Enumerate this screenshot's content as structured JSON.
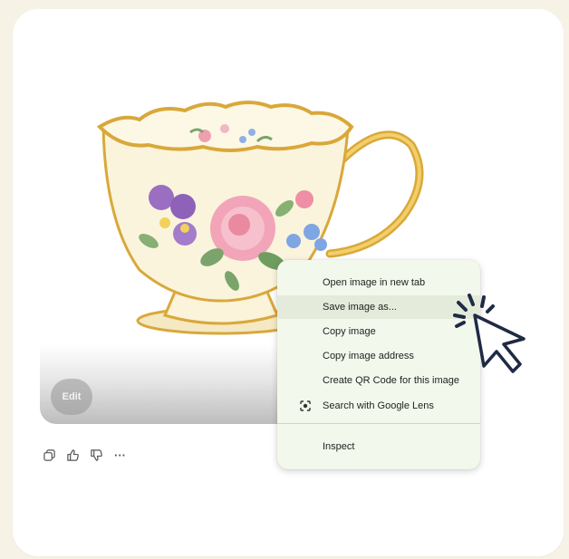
{
  "image": {
    "alt": "Watercolor floral teacup illustration",
    "edit_label": "Edit"
  },
  "actions": {
    "copy_icon": "copy-icon",
    "like_icon": "thumbs-up-icon",
    "dislike_icon": "thumbs-down-icon",
    "more_label": "···"
  },
  "context_menu": {
    "items": [
      {
        "label": "Open image in new tab"
      },
      {
        "label": "Save image as..."
      },
      {
        "label": "Copy image"
      },
      {
        "label": "Copy image address"
      },
      {
        "label": "Create QR Code for this image"
      },
      {
        "label": "Search with Google Lens",
        "icon": "google-lens-icon"
      },
      {
        "label": "Inspect"
      }
    ],
    "highlighted_index": 1
  },
  "colors": {
    "background": "#f7f2e6",
    "menu_background": "#f3f8ec",
    "menu_highlight": "#e4ebdb",
    "cursor_outline": "#1f2a44"
  }
}
